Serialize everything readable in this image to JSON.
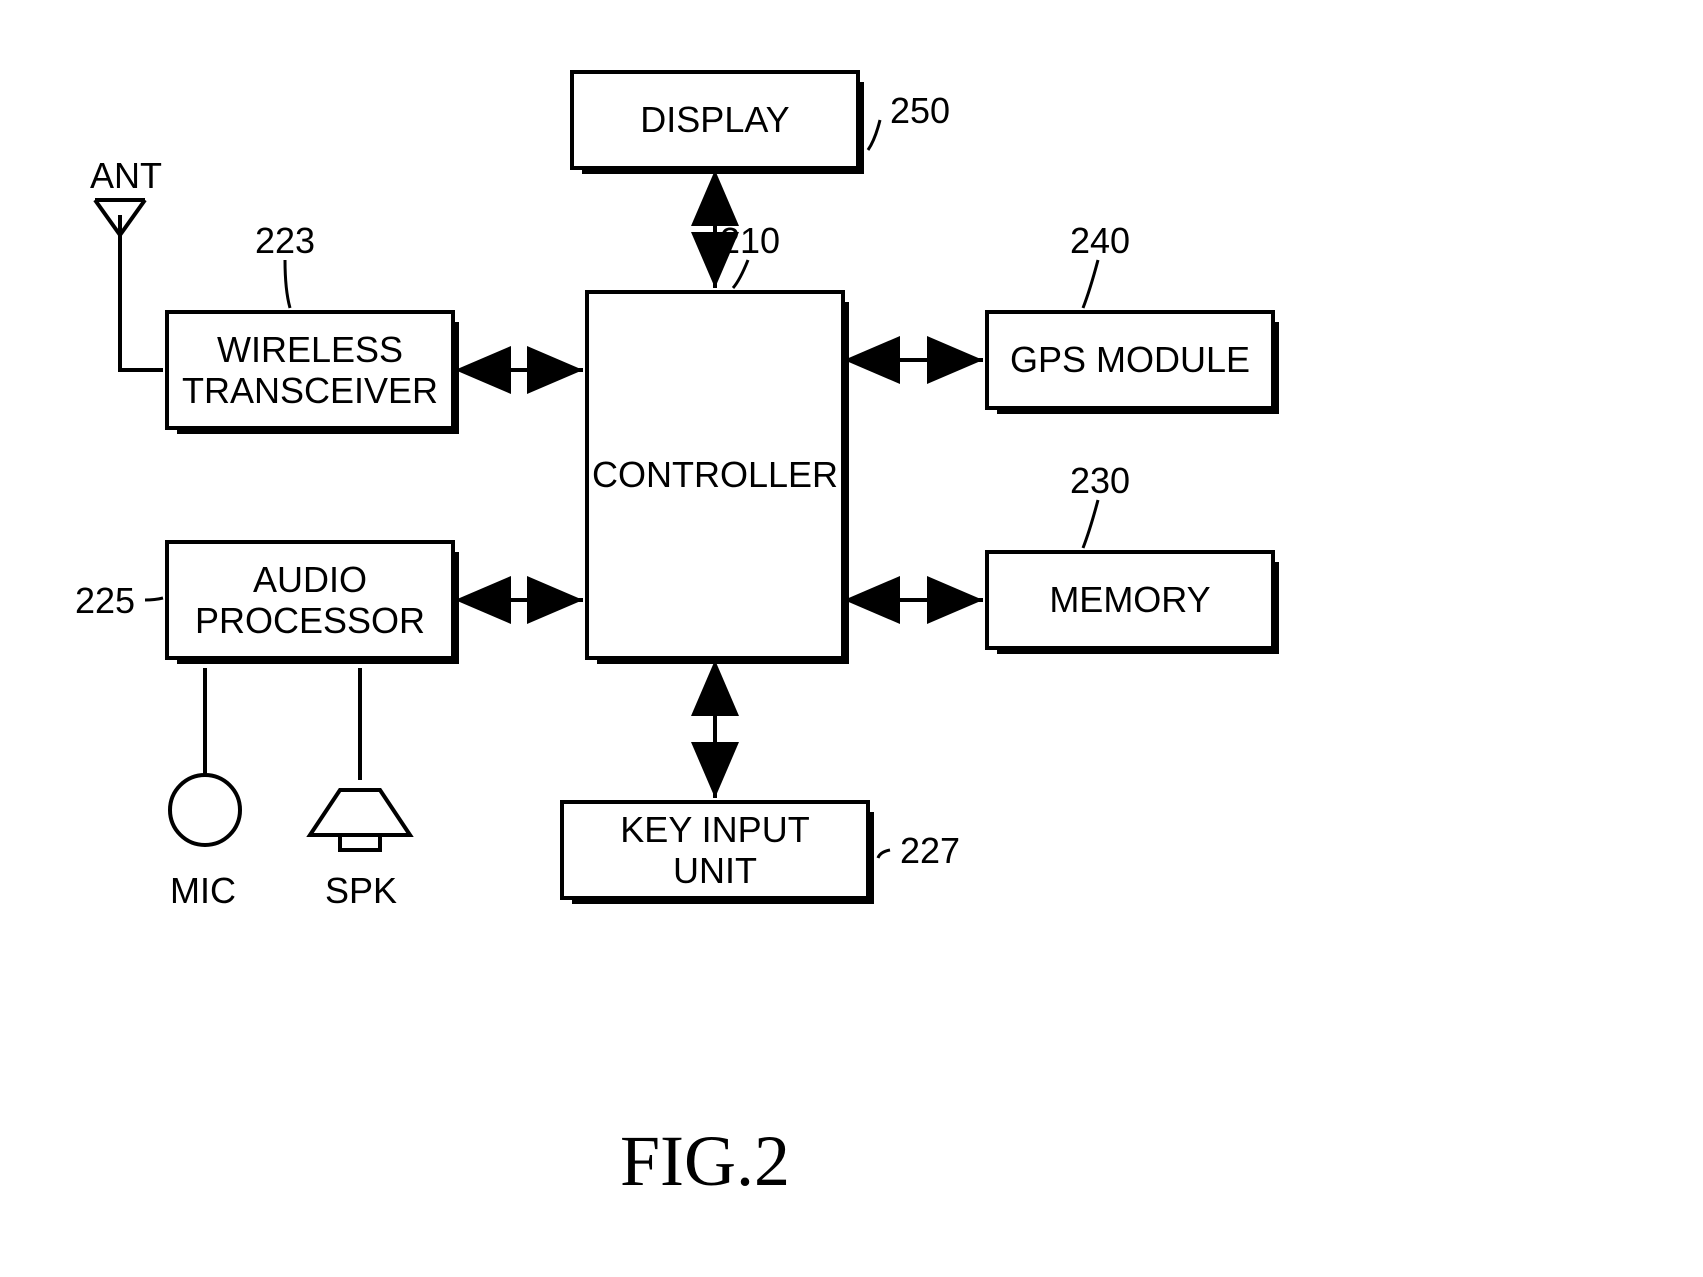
{
  "blocks": {
    "display": {
      "label": "DISPLAY",
      "ref": "250"
    },
    "wireless": {
      "label": "WIRELESS\nTRANSCEIVER",
      "ref": "223"
    },
    "controller": {
      "label": "CONTROLLER",
      "ref": "210"
    },
    "gps": {
      "label": "GPS MODULE",
      "ref": "240"
    },
    "memory": {
      "label": "MEMORY",
      "ref": "230"
    },
    "audio": {
      "label": "AUDIO\nPROCESSOR",
      "ref": "225"
    },
    "keyinput": {
      "label": "KEY INPUT UNIT",
      "ref": "227"
    }
  },
  "symbols": {
    "antenna": "ANT",
    "mic": "MIC",
    "speaker": "SPK"
  },
  "caption": "FIG.2"
}
